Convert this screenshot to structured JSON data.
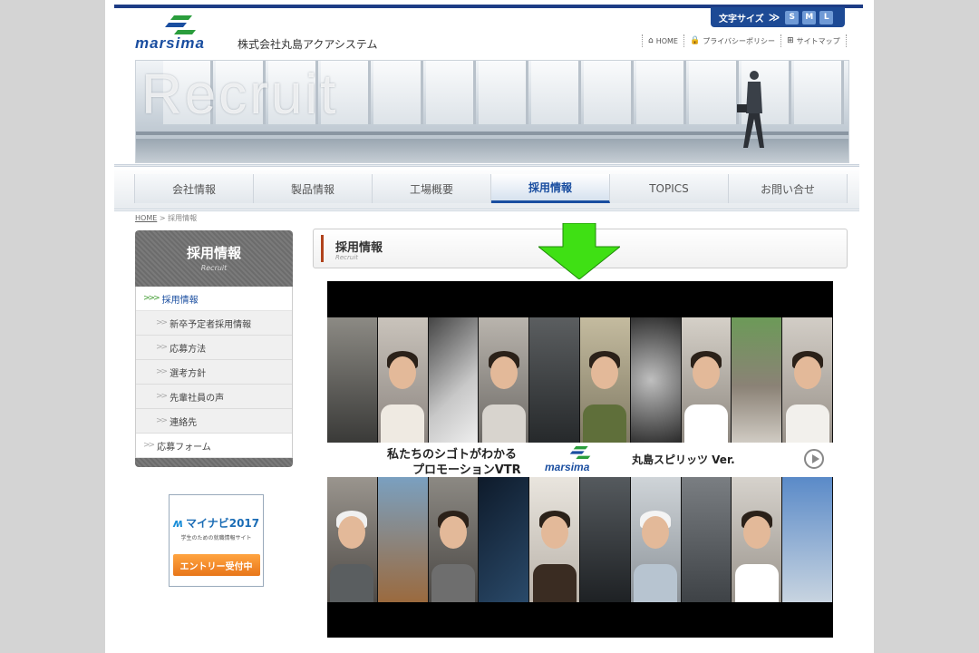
{
  "header": {
    "font_size_label": "文字サイズ",
    "font_size_arrow": "≫",
    "sizes": [
      "S",
      "M",
      "L"
    ],
    "logo_text": "marsima",
    "company": "株式会社丸島アクアシステム",
    "util_nav": [
      {
        "icon": "home-icon",
        "glyph": "⌂",
        "label": "HOME"
      },
      {
        "icon": "lock-icon",
        "glyph": "🔒",
        "label": "プライバシーポリシー"
      },
      {
        "icon": "sitemap-icon",
        "glyph": "⊞",
        "label": "サイトマップ"
      }
    ]
  },
  "banner": {
    "title": "Recruit"
  },
  "nav": {
    "items": [
      "会社情報",
      "製品情報",
      "工場概要",
      "採用情報",
      "TOPICS",
      "お問い合せ"
    ],
    "active_index": 3
  },
  "breadcrumb": {
    "home": "HOME",
    "separator": ">",
    "current": "採用情報"
  },
  "sidebar": {
    "title": "採用情報",
    "subtitle": "Recruit",
    "main": "採用情報",
    "subs": [
      "新卒予定者採用情報",
      "応募方法",
      "選考方針",
      "先輩社員の声",
      "連絡先"
    ],
    "last": "応募フォーム"
  },
  "mynavi": {
    "brand": "マイナビ2017",
    "tagline": "学生のための就職情報サイト",
    "button": "エントリー受付中"
  },
  "page_title": {
    "title": "採用情報",
    "subtitle": "Recruit"
  },
  "video": {
    "line1": "私たちのシゴトがわかる",
    "line2": "プロモーションVTR",
    "logo_text": "marsima",
    "version": "丸島スピリッツ Ver."
  },
  "colors": {
    "brand_blue": "#1d3c85",
    "arrow_green": "#3fe014",
    "cta_orange": "#e8761a",
    "accent_red": "#b0421c"
  }
}
